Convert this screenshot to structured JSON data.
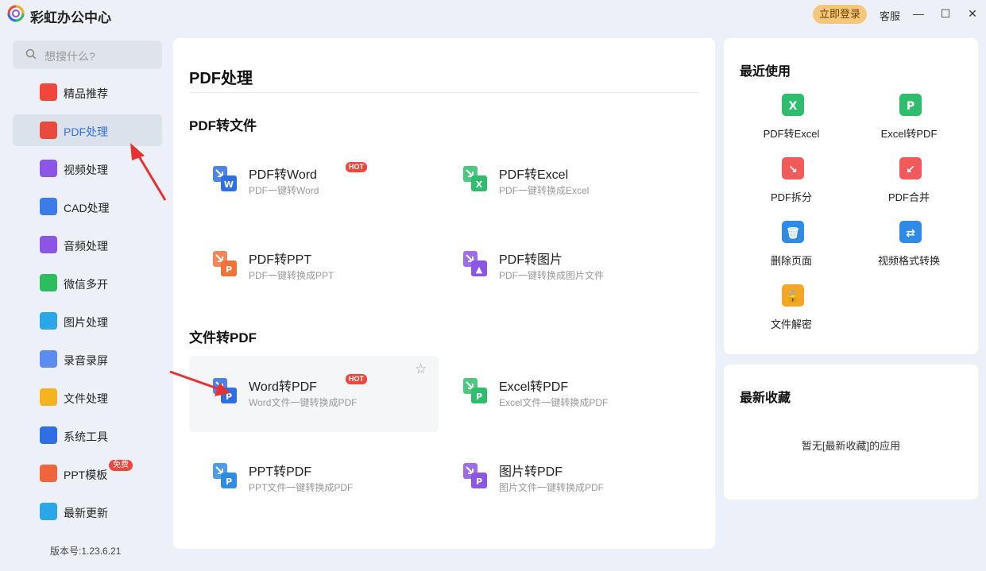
{
  "app": {
    "title": "彩虹办公中心",
    "login_label": "立即登录",
    "service_label": "客服",
    "minimize": "—",
    "maximize": "☐",
    "close": "✕"
  },
  "search": {
    "placeholder": "想搜什么?"
  },
  "sidebar": {
    "items": [
      {
        "label": "精品推荐",
        "icon": "thumbs-up-icon",
        "color": "#f0463c"
      },
      {
        "label": "PDF处理",
        "icon": "pdf-icon",
        "color": "#e84b3c",
        "active": true
      },
      {
        "label": "视频处理",
        "icon": "video-icon",
        "color": "#8b55e6"
      },
      {
        "label": "CAD处理",
        "icon": "cad-icon",
        "color": "#3b7ce8"
      },
      {
        "label": "音频处理",
        "icon": "music-icon",
        "color": "#8b55e6"
      },
      {
        "label": "微信多开",
        "icon": "wechat-icon",
        "color": "#2ebd5c"
      },
      {
        "label": "图片处理",
        "icon": "image-icon",
        "color": "#2aa7e8"
      },
      {
        "label": "录音录屏",
        "icon": "mic-icon",
        "color": "#5b8def"
      },
      {
        "label": "文件处理",
        "icon": "folder-icon",
        "color": "#f5b41e"
      },
      {
        "label": "系统工具",
        "icon": "gear-icon",
        "color": "#2f6fe4"
      },
      {
        "label": "PPT模板",
        "icon": "ppt-icon",
        "color": "#f0663c",
        "badge": "免费"
      },
      {
        "label": "最新更新",
        "icon": "update-icon",
        "color": "#2aa7e8"
      }
    ],
    "version": "版本号:1.23.6.21"
  },
  "main": {
    "title": "PDF处理",
    "sections": [
      {
        "title": "PDF转文件",
        "tools": [
          {
            "name": "PDF转Word",
            "desc": "PDF一键转Word",
            "hot": "HOT",
            "icon": "pdf-to-word-icon",
            "color": "#2f6fe4",
            "letter": "W"
          },
          {
            "name": "PDF转Excel",
            "desc": "PDF一键转换成Excel",
            "icon": "pdf-to-excel-icon",
            "color": "#2ebd6c",
            "letter": "X"
          },
          {
            "name": "PDF转PPT",
            "desc": "PDF一键转换成PPT",
            "icon": "pdf-to-ppt-icon",
            "color": "#f0733c",
            "letter": "P"
          },
          {
            "name": "PDF转图片",
            "desc": "PDF一键转换成图片文件",
            "icon": "pdf-to-image-icon",
            "color": "#8b55e6",
            "letter": "▲"
          }
        ]
      },
      {
        "title": "文件转PDF",
        "tools": [
          {
            "name": "Word转PDF",
            "desc": "Word文件一键转换成PDF",
            "hot": "HOT",
            "icon": "word-to-pdf-icon",
            "color": "#2f6fe4",
            "letter": "P"
          },
          {
            "name": "Excel转PDF",
            "desc": "Excel文件一键转换成PDF",
            "icon": "excel-to-pdf-icon",
            "color": "#2ebd6c",
            "letter": "P"
          },
          {
            "name": "PPT转PDF",
            "desc": "PPT文件一键转换成PDF",
            "icon": "ppt-to-pdf-icon",
            "color": "#2f8be4",
            "letter": "P"
          },
          {
            "name": "图片转PDF",
            "desc": "图片文件一键转换成PDF",
            "icon": "image-to-pdf-icon",
            "color": "#8b55e6",
            "letter": "P"
          }
        ]
      }
    ]
  },
  "recent": {
    "title": "最近使用",
    "items": [
      {
        "label": "PDF转Excel",
        "icon": "pdf-to-excel-icon",
        "color": "#2ebd6c",
        "letter": "X"
      },
      {
        "label": "Excel转PDF",
        "icon": "excel-to-pdf-icon",
        "color": "#2ebd6c",
        "letter": "P"
      },
      {
        "label": "PDF拆分",
        "icon": "pdf-split-icon",
        "color": "#f05a5a",
        "letter": "↘"
      },
      {
        "label": "PDF合并",
        "icon": "pdf-merge-icon",
        "color": "#f05a5a",
        "letter": "↙"
      },
      {
        "label": "删除页面",
        "icon": "delete-page-icon",
        "color": "#2f8be4",
        "letter": "🗑"
      },
      {
        "label": "视频格式转换",
        "icon": "video-convert-icon",
        "color": "#2f8be4",
        "letter": "⇄"
      },
      {
        "label": "文件解密",
        "icon": "file-decrypt-icon",
        "color": "#f5a623",
        "letter": "🔓"
      }
    ]
  },
  "favorites": {
    "title": "最新收藏",
    "empty": "暂无[最新收藏]的应用"
  }
}
